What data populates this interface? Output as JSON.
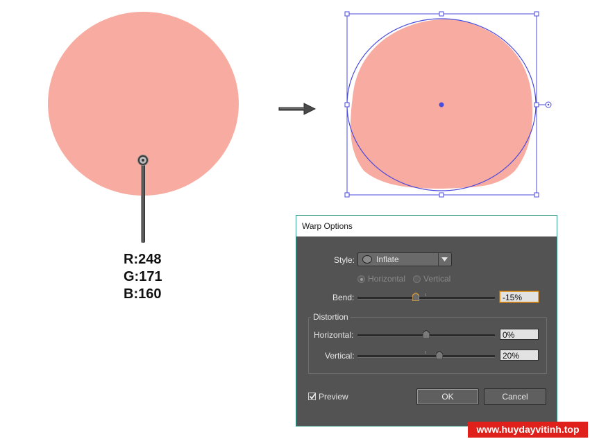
{
  "colors": {
    "shape_fill": "#F8ABA0",
    "selection": "#4a4adc",
    "dialog_bg": "#535353",
    "watermark_bg": "#e0211b"
  },
  "rgb": {
    "r": "R:248",
    "g": "G:171",
    "b": "B:160"
  },
  "arrow_icon": "right-arrow-icon",
  "dialog": {
    "title": "Warp Options",
    "style_label": "Style:",
    "style_value": "Inflate",
    "orientation": {
      "horizontal": "Horizontal",
      "vertical": "Vertical",
      "selected": "Horizontal"
    },
    "bend": {
      "label": "Bend:",
      "value": "-15%",
      "level": -15
    },
    "distortion": {
      "title": "Distortion",
      "horizontal_label": "Horizontal:",
      "horizontal_value": "0%",
      "horizontal_level": 0,
      "vertical_label": "Vertical:",
      "vertical_value": "20%",
      "vertical_level": 20
    },
    "preview": {
      "label": "Preview",
      "checked": true
    },
    "ok_label": "OK",
    "cancel_label": "Cancel"
  },
  "watermark": "www.huydayvitinh.top"
}
